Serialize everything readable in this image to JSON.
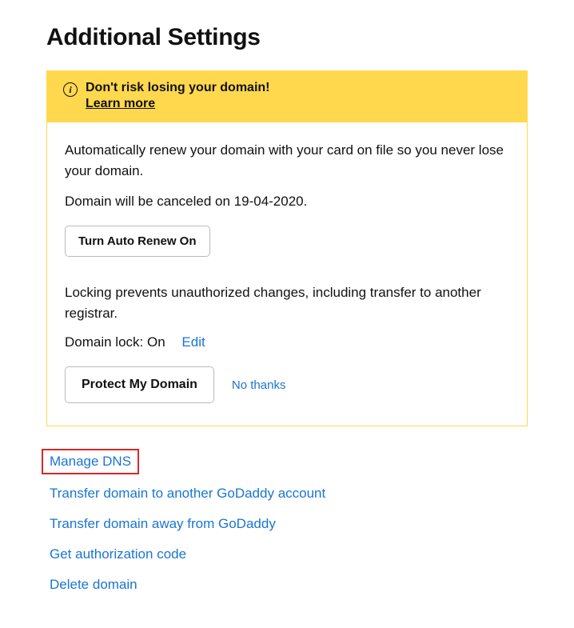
{
  "title": "Additional Settings",
  "warning": {
    "message": "Don't risk losing your domain!",
    "learn_more": "Learn more"
  },
  "auto_renew": {
    "description": "Automatically renew your domain with your card on file so you never lose your domain.",
    "cancel_notice": "Domain will be canceled on 19-04-2020.",
    "button": "Turn Auto Renew On"
  },
  "lock": {
    "description": "Locking prevents unauthorized changes, including transfer to another registrar.",
    "status_label": "Domain lock: ",
    "status_value": "On",
    "edit": "Edit"
  },
  "protect": {
    "button": "Protect My Domain",
    "decline": "No thanks"
  },
  "links": {
    "manage_dns": "Manage DNS",
    "transfer_another": "Transfer domain to another GoDaddy account",
    "transfer_away": "Transfer domain away from GoDaddy",
    "auth_code": "Get authorization code",
    "delete_domain": "Delete domain"
  }
}
